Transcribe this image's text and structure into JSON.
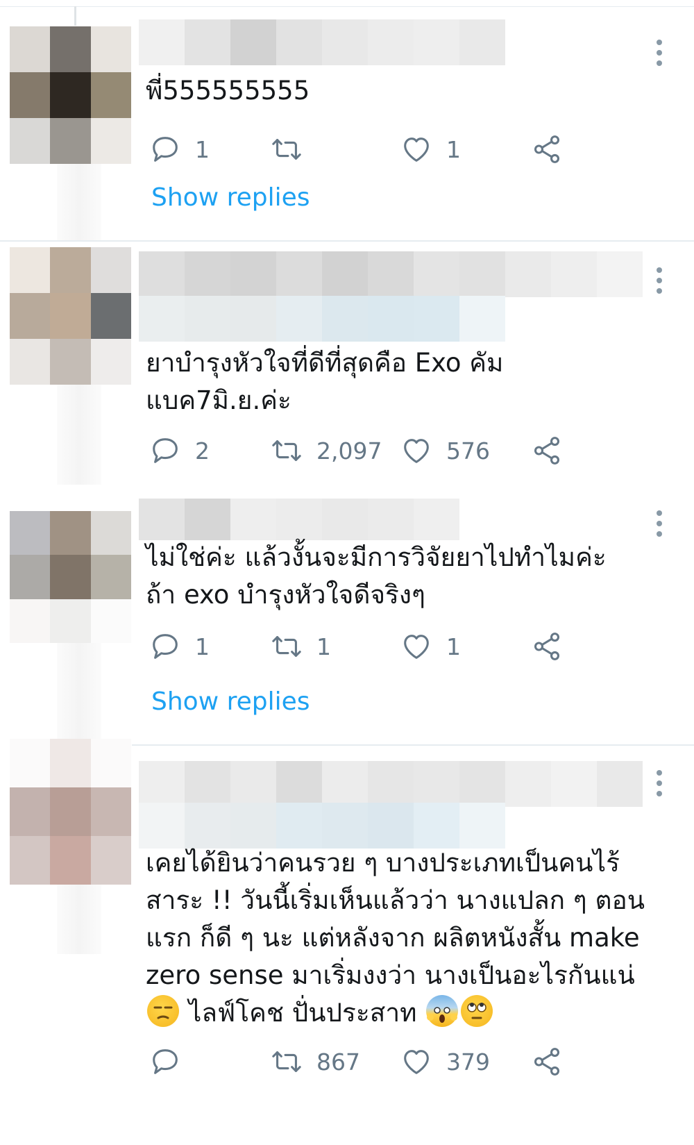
{
  "tweets": [
    {
      "text": "พี่555555555",
      "replies": "1",
      "retweets": "",
      "likes": "1",
      "show_replies": "Show replies"
    },
    {
      "text": "ยาบำรุงหัวใจที่ดีที่สุดคือ Exo คัม\nแบค7มิ.ย.ค่ะ",
      "replies": "2",
      "retweets": "2,097",
      "likes": "576"
    },
    {
      "text": "ไม่ใช่ค่ะ แล้วงั้นจะมีการวิจัยยาไปทำไมค่ะ\nถ้า exo บำรุงหัวใจดีจริงๆ",
      "replies": "1",
      "retweets": "1",
      "likes": "1",
      "show_replies": "Show replies"
    },
    {
      "text_lines": [
        "เคยได้ยินว่าคนรวย ๆ บางประเภทเป็นคนไร้",
        "สาระ !! วันนี้เริ่มเห็นแล้วว่า นางแปลก ๆ ตอน",
        "แรก ก็ดี ๆ นะ แต่หลังจาก ผลิตหนังสั้น make",
        "zero sense มาเริ่มงงว่า นางเป็นอะไรกันแน่"
      ],
      "last_line_text": "ไลฟ์โคช ปั่นประสาท",
      "replies": "",
      "retweets": "867",
      "likes": "379"
    }
  ],
  "icons": {
    "reply": "reply-icon",
    "retweet": "retweet-icon",
    "like": "heart-icon",
    "share": "share-icon",
    "more": "more-options-icon",
    "emoji_1": "unamused-face-emoji",
    "emoji_2": "screaming-face-emoji",
    "emoji_3": "eye-roll-face-emoji"
  },
  "colors": {
    "link": "#1da1f2",
    "icon": "#657786",
    "separator": "#e6ecf0"
  }
}
